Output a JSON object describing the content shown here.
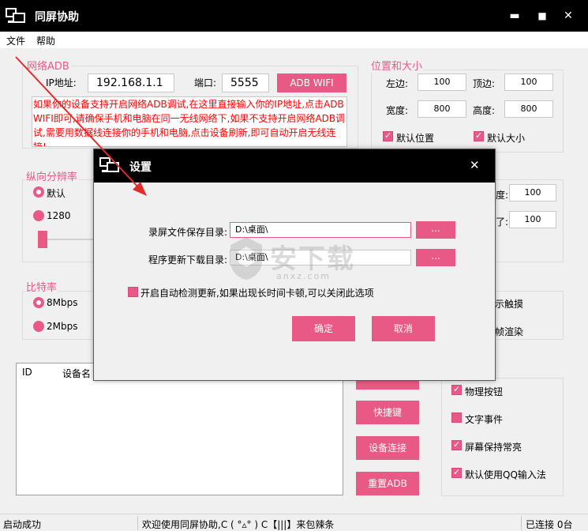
{
  "window": {
    "title": "同屏协助",
    "min": "▬",
    "max": "■",
    "close": "✕"
  },
  "menu": {
    "file": "文件",
    "help": "帮助"
  },
  "adb": {
    "group_label": "网络ADB",
    "ip_label": "IP地址:",
    "ip_value": "192.168.1.1",
    "port_label": "端口:",
    "port_value": "5555",
    "wifi_button": "ADB WIFI",
    "note": "如果你的设备支持开启网络ADB调试,在这里直接输入你的IP地址,点击ADB WIFI即可,请确保手机和电脑在同一无线网络下,如果不支持开启网络ADB调试,需要用数据线连接你的手机和电脑,点击设备刷新,即可自动开启无线连接!"
  },
  "pos": {
    "group_label": "位置和大小",
    "left_label": "左边:",
    "left_value": "100",
    "top_label": "顶边:",
    "top_value": "100",
    "width_label": "宽度:",
    "width_value": "800",
    "height_label": "高度:",
    "height_value": "800",
    "default_pos": "默认位置",
    "default_size": "默认大小"
  },
  "vres": {
    "group_label": "纵向分辨率",
    "opt_default": "默认",
    "opt_1280": "1280"
  },
  "right_mid": {
    "value1": "100",
    "value2": "100",
    "label1": "度:",
    "label2": "了:"
  },
  "bitrate": {
    "group_label": "比特率",
    "opt_8": "8Mbps",
    "opt_2": "2Mbps"
  },
  "touch": {
    "label1": "示触摸",
    "label2": "帧渲染"
  },
  "device_table": {
    "col_id": "ID",
    "col_name": "设备名"
  },
  "buttons": {
    "hotkey": "快捷键",
    "connect": "设备连接",
    "reset": "重置ADB"
  },
  "options": {
    "physical": "物理按钮",
    "text_event": "文字事件",
    "keep_awake": "屏幕保持常亮",
    "qq_input": "默认使用QQ输入法"
  },
  "statusbar": {
    "left": "启动成功",
    "middle": "欢迎使用同屏协助,C ( °▵° ) C【|||】来包辣条",
    "right": "已连接 0台"
  },
  "settings_dialog": {
    "title": "设置",
    "close": "✕",
    "record_label": "录屏文件保存目录:",
    "record_value": "D:\\桌面\\",
    "update_label": "程序更新下载目录:",
    "update_value": "D:\\桌面\\",
    "browse": "...",
    "auto_check": "开启自动检测更新,如果出现长时间卡顿,可以关闭此选项",
    "ok": "确定",
    "cancel": "取消"
  },
  "watermark": {
    "text": "安下载",
    "sub": "anxz.com"
  },
  "colors": {
    "accent": "#e85a85",
    "note_red": "#ff0000",
    "arrow": "#e32b2b"
  }
}
